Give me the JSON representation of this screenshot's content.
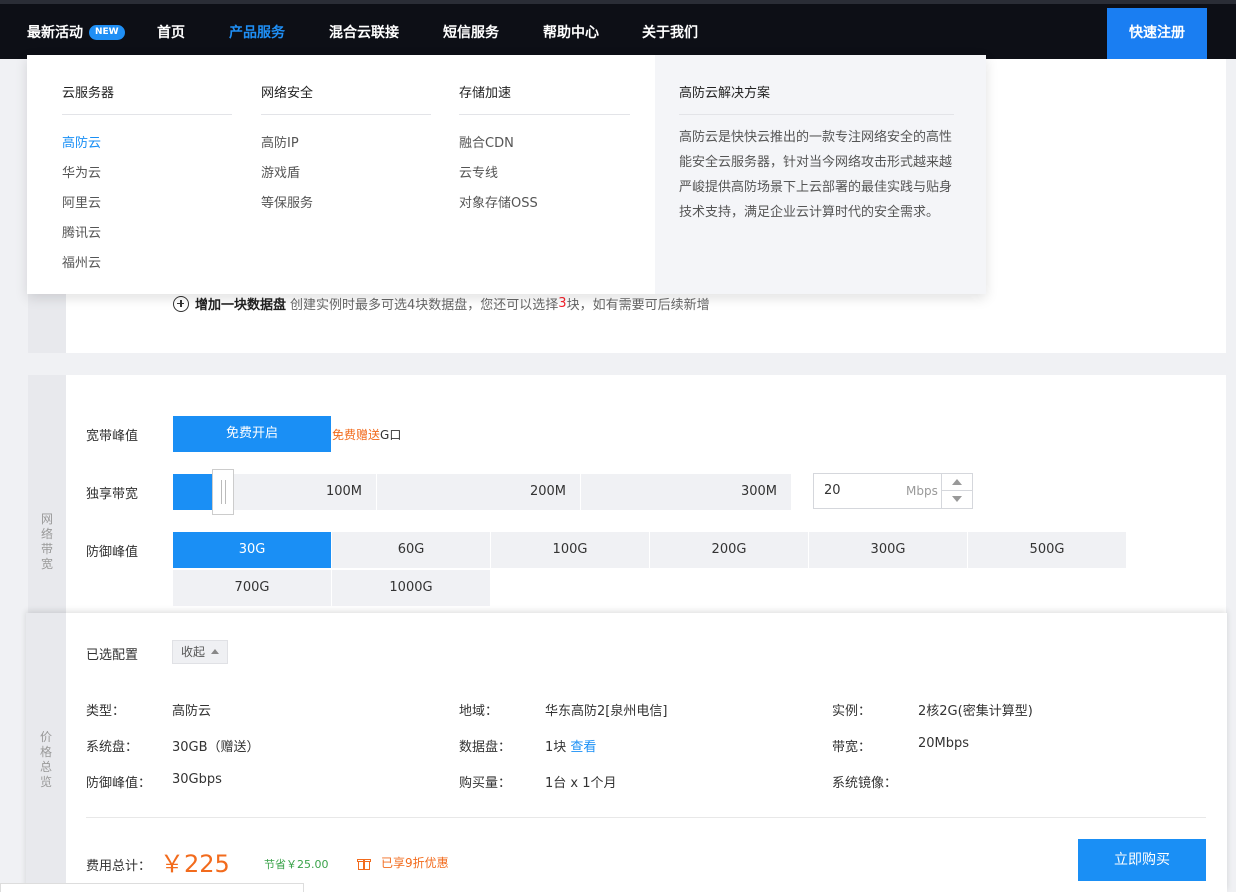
{
  "nav": {
    "latest": "最新活动",
    "new_badge": "NEW",
    "home": "首页",
    "products": "产品服务",
    "hybrid": "混合云联接",
    "sms": "短信服务",
    "help": "帮助中心",
    "about": "关于我们",
    "register": "快速注册"
  },
  "mega_menu": {
    "col1": {
      "title": "云服务器",
      "items": [
        "高防云",
        "华为云",
        "阿里云",
        "腾讯云",
        "福州云"
      ]
    },
    "col2": {
      "title": "网络安全",
      "items": [
        "高防IP",
        "游戏盾",
        "等保服务"
      ]
    },
    "col3": {
      "title": "存储加速",
      "items": [
        "融合CDN",
        "云专线",
        "对象存储OSS"
      ]
    },
    "solution": {
      "title": "高防云解决方案",
      "desc": "高防云是快快云推出的一款专注网络安全的高性能安全云服务器，针对当今网络攻击形式越来越严峻提供高防场景下上云部署的最佳实践与贴身技术支持，满足企业云计算时代的安全需求。"
    }
  },
  "disk": {
    "add_label": "增加一块数据盘",
    "hint_pre": "创建实例时最多可选4块数据盘，您还可以选择",
    "hint_num": "3",
    "hint_post": "块，如有需要可后续新增"
  },
  "network": {
    "side_label": [
      "网",
      "络",
      "带",
      "宽"
    ],
    "peak_label": "宽带峰值",
    "free_btn": "免费开启",
    "free_note_orange": "免费赠送",
    "free_note_rest": "G口",
    "exclusive_label": "独享带宽",
    "slider_marks": [
      "100M",
      "200M",
      "300M"
    ],
    "slider_fraction": 0.067,
    "bandwidth_value": "20",
    "bandwidth_unit": "Mbps",
    "defense_label": "防御峰值",
    "defense_options": [
      "30G",
      "60G",
      "100G",
      "200G",
      "300G",
      "500G",
      "700G",
      "1000G"
    ],
    "defense_selected": "30G"
  },
  "summary": {
    "side_label": [
      "价",
      "格",
      "总",
      "览"
    ],
    "title": "已选配置",
    "collapse": "收起",
    "type_k": "类型：",
    "type_v": "高防云",
    "region_k": "地域：",
    "region_v": "华东高防2[泉州电信]",
    "instance_k": "实例：",
    "instance_v": "2核2G(密集计算型)",
    "sysdisk_k": "系统盘：",
    "sysdisk_v": "30GB（赠送）",
    "datadisk_k": "数据盘：",
    "datadisk_v": "1块",
    "datadisk_link": "查看",
    "bw_k": "带宽：",
    "bw_v": "20Mbps",
    "defense_k": "防御峰值：",
    "defense_v": "30Gbps",
    "qty_k": "购买量：",
    "qty_v": "1台 x 1个月",
    "image_k": "系统镜像：",
    "image_v": "",
    "total_label": "费用总计：",
    "total_price": "￥225",
    "save_note": "节省￥25.00",
    "discount": "已享9折优惠",
    "buy": "立即购买"
  },
  "colors": {
    "accent": "#1a8ff5",
    "orange": "#f26b1d",
    "green": "#3aa24a",
    "nav_bg": "#0d0f16"
  }
}
